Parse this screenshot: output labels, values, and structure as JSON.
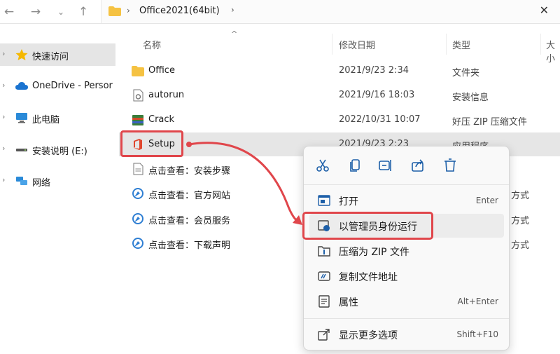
{
  "address": {
    "folder_name": "Office2021(64bit)",
    "separator": "›"
  },
  "sidebar": {
    "items": [
      {
        "label": "快速访问",
        "icon": "star-icon"
      },
      {
        "label": "OneDrive - Persor",
        "icon": "cloud-icon"
      },
      {
        "label": "此电脑",
        "icon": "computer-icon"
      },
      {
        "label": "安装说明 (E:)",
        "icon": "drive-icon"
      },
      {
        "label": "网络",
        "icon": "network-icon"
      }
    ]
  },
  "columns": {
    "name": "名称",
    "date": "修改日期",
    "type": "类型",
    "size": "大小"
  },
  "files": [
    {
      "name": "Office",
      "date": "2021/9/23 2:34",
      "type": "文件夹",
      "icon": "folder-icon"
    },
    {
      "name": "autorun",
      "date": "2021/9/16 18:03",
      "type": "安装信息",
      "icon": "settings-file-icon"
    },
    {
      "name": "Crack",
      "date": "2022/10/31 10:07",
      "type": "好压 ZIP 压缩文件",
      "icon": "zip-icon"
    },
    {
      "name": "Setup",
      "date": "2021/9/23 2:23",
      "type": "应用程序",
      "icon": "office-icon"
    },
    {
      "name": "点击查看：安装步骤",
      "date": "",
      "type": "",
      "icon": "document-icon"
    },
    {
      "name": "点击查看：官方网站",
      "date": "",
      "type": "方式",
      "icon": "shortcut-icon"
    },
    {
      "name": "点击查看：会员服务",
      "date": "",
      "type": "方式",
      "icon": "shortcut-icon"
    },
    {
      "name": "点击查看：下载声明",
      "date": "",
      "type": "方式",
      "icon": "shortcut-icon"
    }
  ],
  "context_menu": {
    "toolbar": [
      "cut-icon",
      "copy-icon",
      "rename-icon",
      "share-icon",
      "delete-icon"
    ],
    "items": [
      {
        "label": "打开",
        "shortcut": "Enter",
        "icon": "open-icon"
      },
      {
        "label": "以管理员身份运行",
        "shortcut": "",
        "icon": "admin-shield-icon"
      },
      {
        "label": "压缩为 ZIP 文件",
        "shortcut": "",
        "icon": "zip-compress-icon"
      },
      {
        "label": "复制文件地址",
        "shortcut": "",
        "icon": "copy-path-icon"
      },
      {
        "label": "属性",
        "shortcut": "Alt+Enter",
        "icon": "properties-icon"
      },
      {
        "label": "显示更多选项",
        "shortcut": "Shift+F10",
        "icon": "more-options-icon"
      }
    ]
  },
  "colors": {
    "highlight": "#e0464b",
    "accent": "#1d5fa8",
    "folder": "#f5c242"
  }
}
